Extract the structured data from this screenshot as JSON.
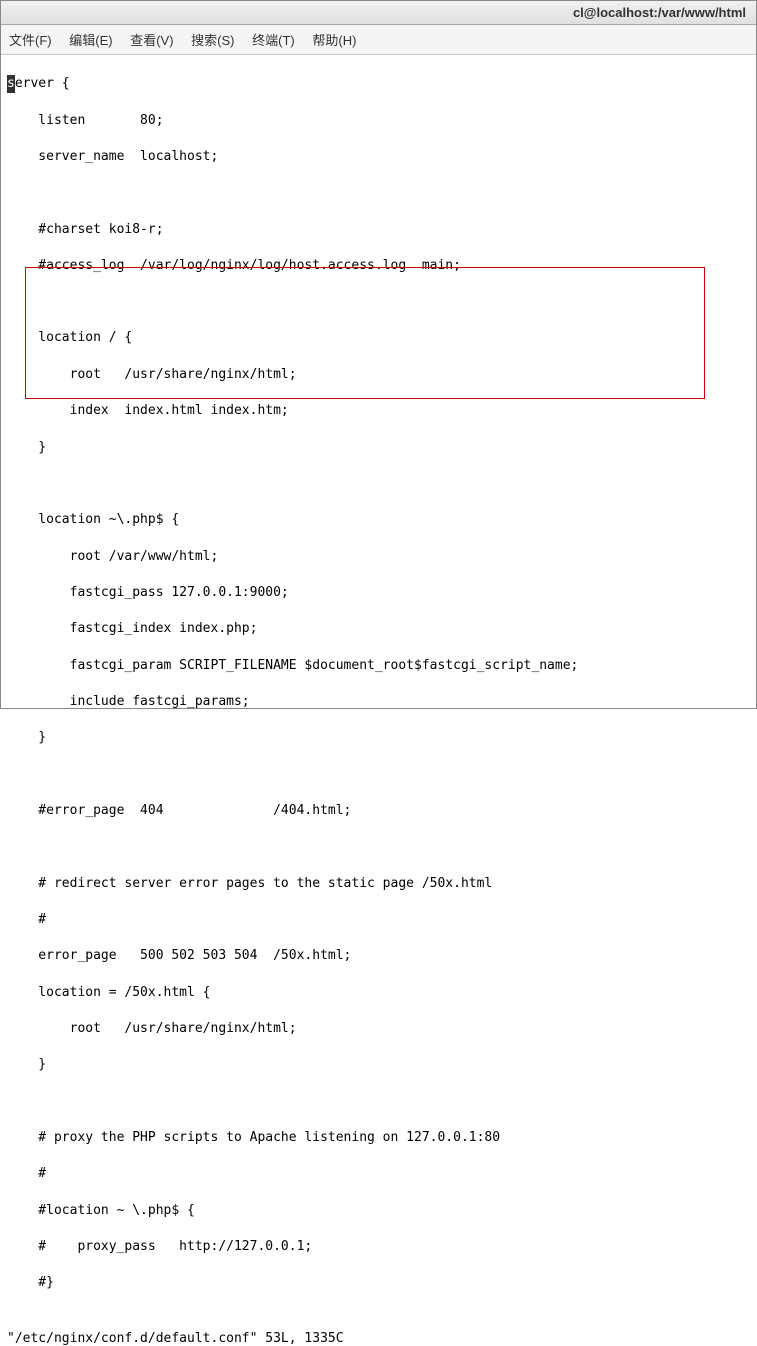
{
  "window": {
    "title": "cl@localhost:/var/www/html"
  },
  "menu": {
    "file": "文件(F)",
    "edit": "编辑(E)",
    "view": "查看(V)",
    "search": "搜索(S)",
    "terminal": "终端(T)",
    "help": "帮助(H)"
  },
  "lines": {
    "l0a": "s",
    "l0b": "erver {",
    "l1": "    listen       80;",
    "l2": "    server_name  localhost;",
    "l3": "",
    "l4": "    #charset koi8-r;",
    "l5": "    #access_log  /var/log/nginx/log/host.access.log  main;",
    "l6": "",
    "l7": "    location / {",
    "l8": "        root   /usr/share/nginx/html;",
    "l9": "        index  index.html index.htm;",
    "l10": "    }",
    "l11": "",
    "l12": "    location ~\\.php$ {",
    "l13": "        root /var/www/html;",
    "l14": "        fastcgi_pass 127.0.0.1:9000;",
    "l15": "        fastcgi_index index.php;",
    "l16": "        fastcgi_param SCRIPT_FILENAME $document_root$fastcgi_script_name;",
    "l17": "        include fastcgi_params;",
    "l18": "    }",
    "l19": "",
    "l20": "    #error_page  404              /404.html;",
    "l21": "",
    "l22": "    # redirect server error pages to the static page /50x.html",
    "l23": "    #",
    "l24": "    error_page   500 502 503 504  /50x.html;",
    "l25": "    location = /50x.html {",
    "l26": "        root   /usr/share/nginx/html;",
    "l27": "    }",
    "l28": "",
    "l29": "    # proxy the PHP scripts to Apache listening on 127.0.0.1:80",
    "l30": "    #",
    "l31": "    #location ~ \\.php$ {",
    "l32": "    #    proxy_pass   http://127.0.0.1;",
    "l33": "    #}"
  },
  "status": "\"/etc/nginx/conf.d/default.conf\" 53L, 1335C"
}
